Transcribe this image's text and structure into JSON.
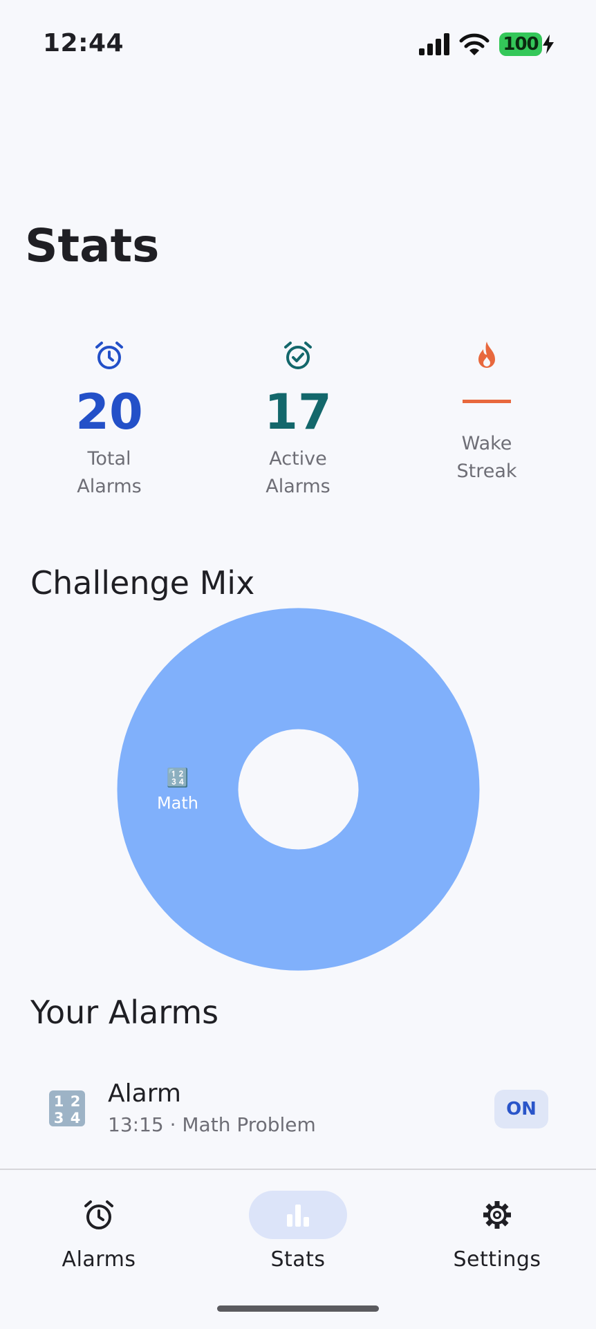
{
  "status_bar": {
    "time": "12:44",
    "battery": "100"
  },
  "page": {
    "title": "Stats"
  },
  "stats": [
    {
      "value": "20",
      "label": "Total Alarms",
      "icon": "alarm-clock-icon",
      "color": "#2350c8"
    },
    {
      "value": "17",
      "label": "Active Alarms",
      "icon": "alarm-check-icon",
      "color": "#13676b"
    },
    {
      "value": "",
      "label": "Wake Streak",
      "icon": "flame-icon",
      "color": "#e8683d"
    }
  ],
  "challenge_mix": {
    "title": "Challenge Mix",
    "chart_data": {
      "type": "pie",
      "categories": [
        "Math"
      ],
      "values": [
        1
      ],
      "labels": [
        "Math"
      ],
      "label_icons": [
        "🔢"
      ],
      "colors": [
        "#80b0fb"
      ],
      "donut": true
    }
  },
  "alarms": {
    "title": "Your Alarms",
    "items": [
      {
        "name": "Alarm",
        "detail": "13:15 · Math Problem",
        "status": "ON",
        "icon": "🔢"
      }
    ]
  },
  "nav": {
    "items": [
      {
        "label": "Alarms",
        "icon": "alarm-clock-icon",
        "active": false
      },
      {
        "label": "Stats",
        "icon": "bar-chart-icon",
        "active": true
      },
      {
        "label": "Settings",
        "icon": "gear-icon",
        "active": false
      }
    ]
  },
  "colors": {
    "accent": "#2350c8",
    "nav_active_bg": "#dce4f9",
    "background": "#f7f8fc"
  }
}
